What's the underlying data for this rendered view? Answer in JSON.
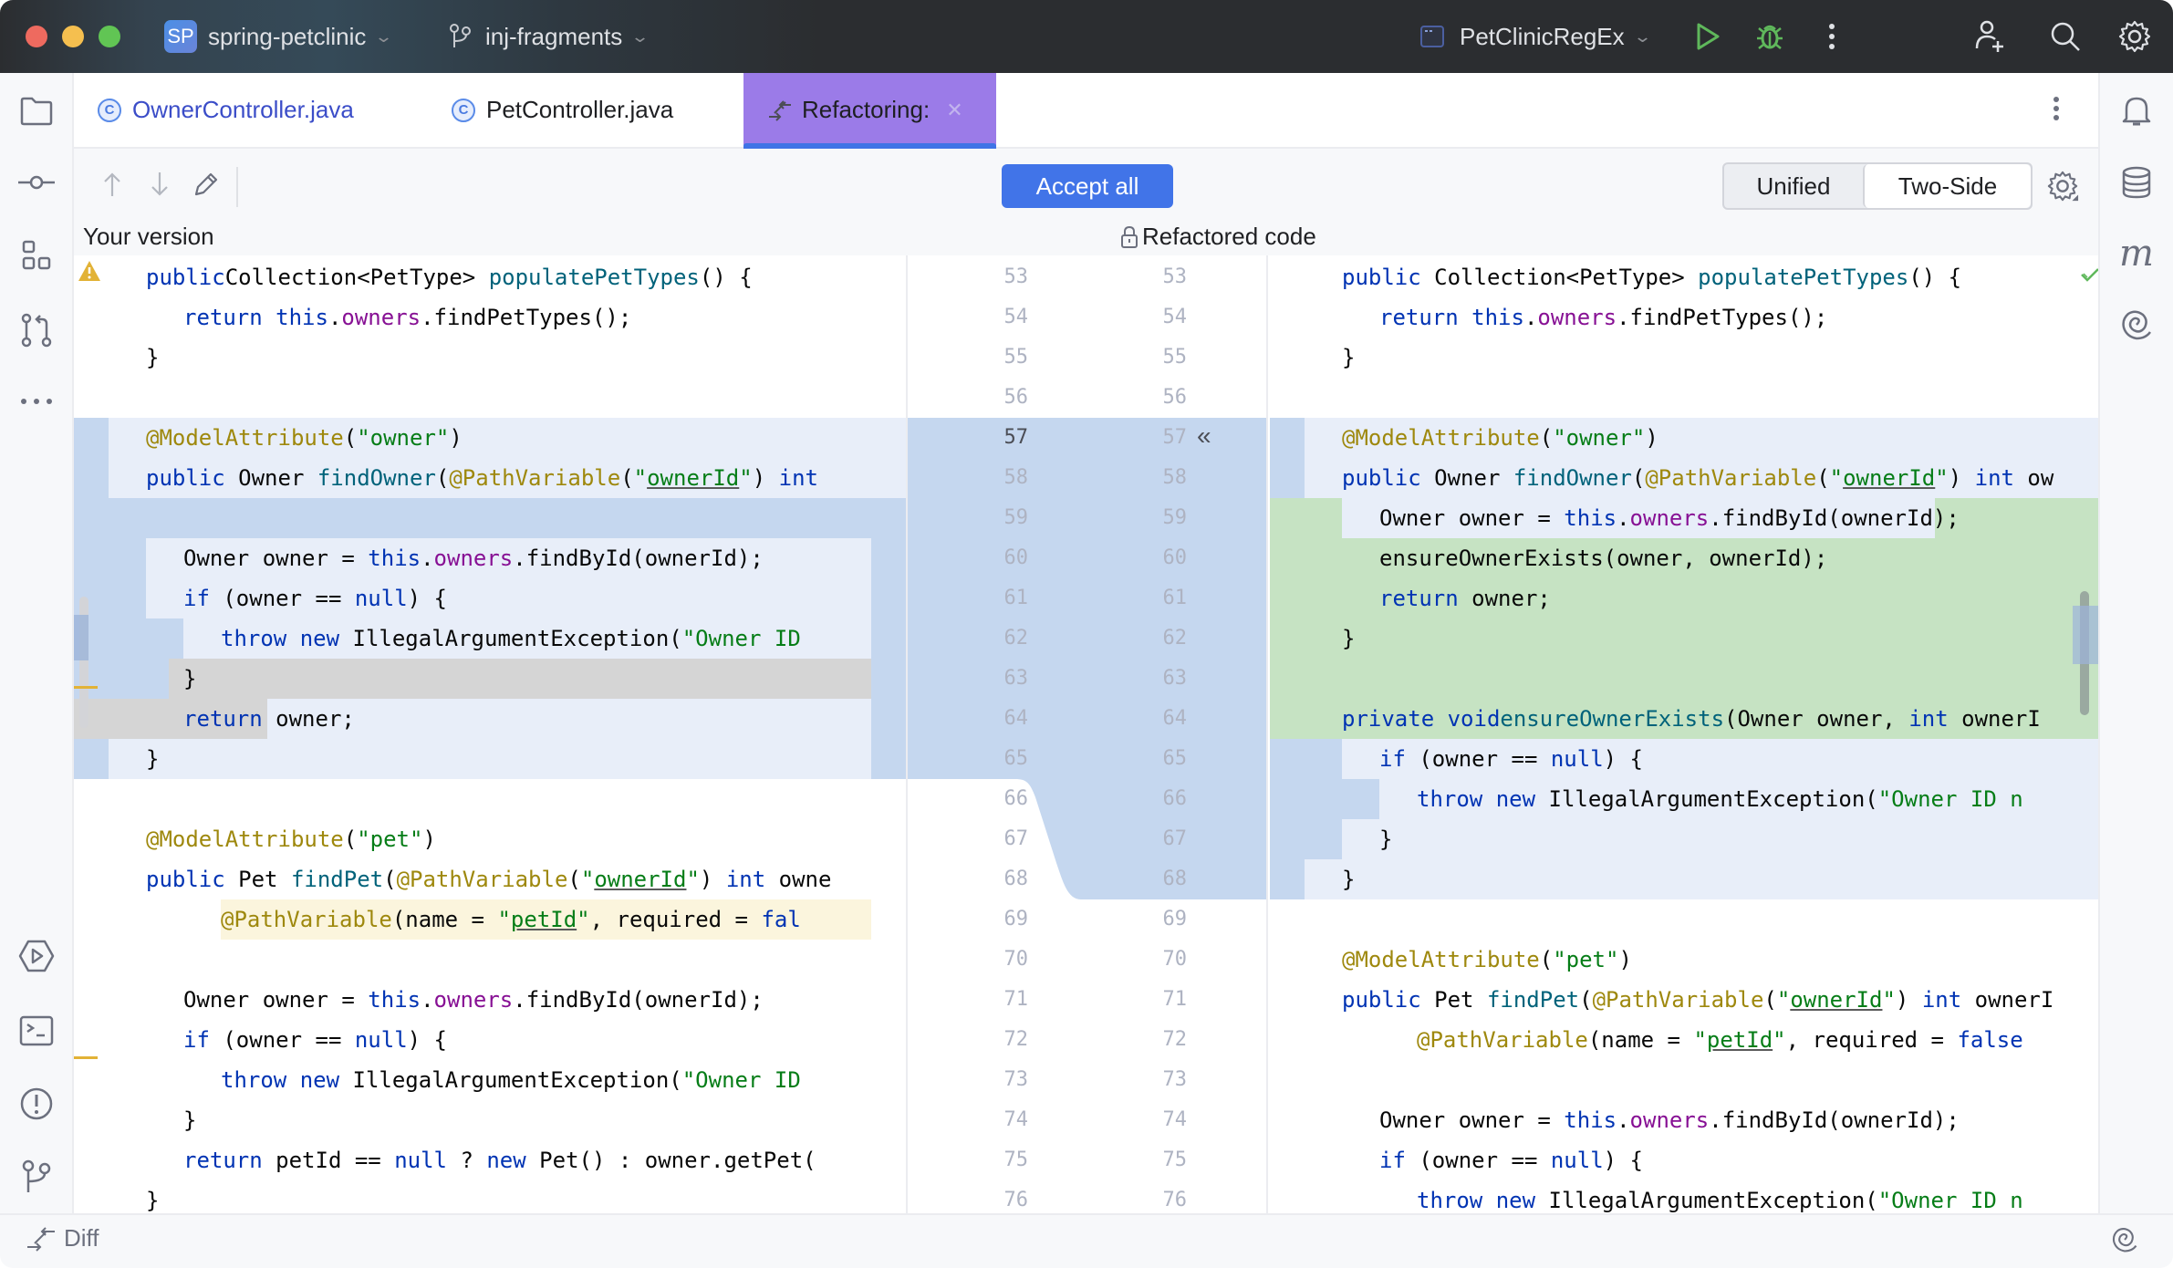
{
  "titlebar": {
    "project_badge": "SP",
    "project_name": "spring-petclinic",
    "branch_name": "inj-fragments",
    "run_config": "PetClinicRegEx",
    "colors": {
      "run": "#5fb85b",
      "debug": "#5fb85b"
    }
  },
  "tabs": [
    {
      "label": "OwnerController.java",
      "icon": "class-icon"
    },
    {
      "label": "PetController.java",
      "icon": "class-icon"
    },
    {
      "label": "Refactoring:",
      "icon": "refactor-icon",
      "active": true
    }
  ],
  "toolbar": {
    "accept_all": "Accept all",
    "view_modes": [
      "Unified",
      "Two-Side"
    ],
    "selected_view": "Two-Side",
    "accent_color": "#4174e8"
  },
  "labels": {
    "left": "Your version",
    "right": "Refactored code"
  },
  "left_lines": [
    {
      "n": 53,
      "indent": 1,
      "tokens": [
        [
          "k",
          "public"
        ],
        [
          "",
          "Collection<PetType> "
        ],
        [
          "f",
          "populatePetTypes"
        ],
        [
          "",
          "() {"
        ]
      ]
    },
    {
      "n": 54,
      "indent": 2,
      "tokens": [
        [
          "k",
          "return this"
        ],
        [
          "",
          "."
        ],
        [
          "m",
          "owners"
        ],
        [
          "",
          ".findPetTypes();"
        ]
      ]
    },
    {
      "n": 55,
      "indent": 1,
      "tokens": [
        [
          "",
          "}"
        ]
      ]
    },
    {
      "n": 56,
      "indent": 0,
      "tokens": []
    },
    {
      "n": 57,
      "indent": 1,
      "tokens": [
        [
          "a",
          "@ModelAttribute"
        ],
        [
          "",
          "("
        ],
        [
          "s",
          "\"owner\""
        ],
        [
          "",
          ")"
        ]
      ]
    },
    {
      "n": 58,
      "indent": 1,
      "tokens": [
        [
          "k",
          "public"
        ],
        [
          "",
          " Owner "
        ],
        [
          "f",
          "findOwner"
        ],
        [
          "",
          "("
        ],
        [
          "a",
          "@PathVariable"
        ],
        [
          "",
          "("
        ],
        [
          "s",
          "\""
        ],
        [
          "su",
          "ownerId"
        ],
        [
          "s",
          "\""
        ],
        [
          "",
          ") "
        ],
        [
          "k",
          "int"
        ]
      ]
    },
    {
      "n": 59,
      "indent": 0,
      "tokens": []
    },
    {
      "n": 60,
      "indent": 2,
      "tokens": [
        [
          "",
          "Owner owner = "
        ],
        [
          "k",
          "this"
        ],
        [
          "",
          "."
        ],
        [
          "m",
          "owners"
        ],
        [
          "",
          ".findById(ownerId);"
        ]
      ]
    },
    {
      "n": 61,
      "indent": 2,
      "tokens": [
        [
          "k",
          "if"
        ],
        [
          "",
          " (owner == "
        ],
        [
          "k",
          "null"
        ],
        [
          "",
          ") {"
        ]
      ]
    },
    {
      "n": 62,
      "indent": 3,
      "tokens": [
        [
          "k",
          "throw new"
        ],
        [
          "",
          " IllegalArgumentException("
        ],
        [
          "s",
          "\"Owner ID"
        ]
      ]
    },
    {
      "n": 63,
      "indent": 2,
      "tokens": [
        [
          "",
          "}"
        ]
      ]
    },
    {
      "n": 64,
      "indent": 2,
      "tokens": [
        [
          "k",
          "return"
        ],
        [
          "",
          " owner;"
        ]
      ]
    },
    {
      "n": 65,
      "indent": 1,
      "tokens": [
        [
          "",
          "}"
        ]
      ]
    },
    {
      "n": 66,
      "indent": 0,
      "tokens": []
    },
    {
      "n": 67,
      "indent": 1,
      "tokens": [
        [
          "a",
          "@ModelAttribute"
        ],
        [
          "",
          "("
        ],
        [
          "s",
          "\"pet\""
        ],
        [
          "",
          ")"
        ]
      ]
    },
    {
      "n": 68,
      "indent": 1,
      "tokens": [
        [
          "k",
          "public"
        ],
        [
          "",
          " Pet "
        ],
        [
          "f",
          "findPet"
        ],
        [
          "",
          "("
        ],
        [
          "a",
          "@PathVariable"
        ],
        [
          "",
          "("
        ],
        [
          "s",
          "\""
        ],
        [
          "su",
          "ownerId"
        ],
        [
          "s",
          "\""
        ],
        [
          "",
          ") "
        ],
        [
          "k",
          "int"
        ],
        [
          "",
          " owne"
        ]
      ]
    },
    {
      "n": 69,
      "indent": 3,
      "tokens": [
        [
          "a",
          "@PathVariable"
        ],
        [
          "",
          "(name = "
        ],
        [
          "s",
          "\""
        ],
        [
          "su",
          "petId"
        ],
        [
          "s",
          "\""
        ],
        [
          "",
          ", required = "
        ],
        [
          "k",
          "fal"
        ]
      ]
    },
    {
      "n": 70,
      "indent": 0,
      "tokens": []
    },
    {
      "n": 71,
      "indent": 2,
      "tokens": [
        [
          "",
          "Owner owner = "
        ],
        [
          "k",
          "this"
        ],
        [
          "",
          "."
        ],
        [
          "m",
          "owners"
        ],
        [
          "",
          ".findById(ownerId);"
        ]
      ]
    },
    {
      "n": 72,
      "indent": 2,
      "tokens": [
        [
          "k",
          "if"
        ],
        [
          "",
          " (owner == "
        ],
        [
          "k",
          "null"
        ],
        [
          "",
          ") {"
        ]
      ]
    },
    {
      "n": 73,
      "indent": 3,
      "tokens": [
        [
          "k",
          "throw new"
        ],
        [
          "",
          " IllegalArgumentException("
        ],
        [
          "s",
          "\"Owner ID"
        ]
      ]
    },
    {
      "n": 74,
      "indent": 2,
      "tokens": [
        [
          "",
          "}"
        ]
      ]
    },
    {
      "n": 75,
      "indent": 2,
      "tokens": [
        [
          "k",
          "return"
        ],
        [
          "",
          " petId == "
        ],
        [
          "k",
          "null"
        ],
        [
          "",
          " ? "
        ],
        [
          "k",
          "new"
        ],
        [
          "",
          " Pet() : owner.getPet("
        ]
      ]
    },
    {
      "n": 76,
      "indent": 1,
      "tokens": [
        [
          "",
          "}"
        ]
      ]
    }
  ],
  "right_lines": [
    {
      "n": 53,
      "indent": 1,
      "tokens": [
        [
          "k",
          "public"
        ],
        [
          "",
          " Collection<PetType> "
        ],
        [
          "f",
          "populatePetTypes"
        ],
        [
          "",
          "() {"
        ]
      ]
    },
    {
      "n": 54,
      "indent": 2,
      "tokens": [
        [
          "k",
          "return this"
        ],
        [
          "",
          "."
        ],
        [
          "m",
          "owners"
        ],
        [
          "",
          ".findPetTypes();"
        ]
      ]
    },
    {
      "n": 55,
      "indent": 1,
      "tokens": [
        [
          "",
          "}"
        ]
      ]
    },
    {
      "n": 56,
      "indent": 0,
      "tokens": []
    },
    {
      "n": 57,
      "indent": 1,
      "tokens": [
        [
          "a",
          "@ModelAttribute"
        ],
        [
          "",
          "("
        ],
        [
          "s",
          "\"owner\""
        ],
        [
          "",
          ")"
        ]
      ]
    },
    {
      "n": 58,
      "indent": 1,
      "tokens": [
        [
          "k",
          "public"
        ],
        [
          "",
          " Owner "
        ],
        [
          "f",
          "findOwner"
        ],
        [
          "",
          "("
        ],
        [
          "a",
          "@PathVariable"
        ],
        [
          "",
          "("
        ],
        [
          "s",
          "\""
        ],
        [
          "su",
          "ownerId"
        ],
        [
          "s",
          "\""
        ],
        [
          "",
          ") "
        ],
        [
          "k",
          "int"
        ],
        [
          "",
          " ow"
        ]
      ]
    },
    {
      "n": 59,
      "indent": 2,
      "tokens": [
        [
          "",
          "Owner owner = "
        ],
        [
          "k",
          "this"
        ],
        [
          "",
          "."
        ],
        [
          "m",
          "owners"
        ],
        [
          "",
          ".findById(ownerId);"
        ]
      ]
    },
    {
      "n": 60,
      "indent": 2,
      "tokens": [
        [
          "",
          "ensureOwnerExists(owner, ownerId);"
        ]
      ]
    },
    {
      "n": 61,
      "indent": 2,
      "tokens": [
        [
          "k",
          "return"
        ],
        [
          "",
          " owner;"
        ]
      ]
    },
    {
      "n": 62,
      "indent": 1,
      "tokens": [
        [
          "",
          "}"
        ]
      ]
    },
    {
      "n": 63,
      "indent": 0,
      "tokens": []
    },
    {
      "n": 64,
      "indent": 1,
      "tokens": [
        [
          "k",
          "private void"
        ],
        [
          " ",
          ""
        ],
        [
          "f",
          "ensureOwnerExists"
        ],
        [
          "",
          "(Owner owner, "
        ],
        [
          "k",
          "int"
        ],
        [
          "",
          " ownerI"
        ]
      ]
    },
    {
      "n": 65,
      "indent": 2,
      "tokens": [
        [
          "k",
          "if"
        ],
        [
          "",
          " (owner == "
        ],
        [
          "k",
          "null"
        ],
        [
          "",
          ") {"
        ]
      ]
    },
    {
      "n": 66,
      "indent": 3,
      "tokens": [
        [
          "k",
          "throw new"
        ],
        [
          "",
          " IllegalArgumentException("
        ],
        [
          "s",
          "\"Owner ID n"
        ]
      ]
    },
    {
      "n": 67,
      "indent": 2,
      "tokens": [
        [
          "",
          "}"
        ]
      ]
    },
    {
      "n": 68,
      "indent": 1,
      "tokens": [
        [
          "",
          "}"
        ]
      ]
    },
    {
      "n": 69,
      "indent": 0,
      "tokens": []
    },
    {
      "n": 70,
      "indent": 1,
      "tokens": [
        [
          "a",
          "@ModelAttribute"
        ],
        [
          "",
          "("
        ],
        [
          "s",
          "\"pet\""
        ],
        [
          "",
          ")"
        ]
      ]
    },
    {
      "n": 71,
      "indent": 1,
      "tokens": [
        [
          "k",
          "public"
        ],
        [
          "",
          " Pet "
        ],
        [
          "f",
          "findPet"
        ],
        [
          "",
          "("
        ],
        [
          "a",
          "@PathVariable"
        ],
        [
          "",
          "("
        ],
        [
          "s",
          "\""
        ],
        [
          "su",
          "ownerId"
        ],
        [
          "s",
          "\""
        ],
        [
          "",
          ") "
        ],
        [
          "k",
          "int"
        ],
        [
          "",
          " ownerI"
        ]
      ]
    },
    {
      "n": 72,
      "indent": 3,
      "tokens": [
        [
          "a",
          "@PathVariable"
        ],
        [
          "",
          "(name = "
        ],
        [
          "s",
          "\""
        ],
        [
          "su",
          "petId"
        ],
        [
          "s",
          "\""
        ],
        [
          "",
          ", required = "
        ],
        [
          "k",
          "false"
        ]
      ]
    },
    {
      "n": 73,
      "indent": 0,
      "tokens": []
    },
    {
      "n": 74,
      "indent": 2,
      "tokens": [
        [
          "",
          "Owner owner = "
        ],
        [
          "k",
          "this"
        ],
        [
          "",
          "."
        ],
        [
          "m",
          "owners"
        ],
        [
          "",
          ".findById(ownerId);"
        ]
      ]
    },
    {
      "n": 75,
      "indent": 2,
      "tokens": [
        [
          "k",
          "if"
        ],
        [
          "",
          " (owner == "
        ],
        [
          "k",
          "null"
        ],
        [
          "",
          ") {"
        ]
      ]
    },
    {
      "n": 76,
      "indent": 3,
      "tokens": [
        [
          "k",
          "throw new"
        ],
        [
          "",
          " IllegalArgumentException("
        ],
        [
          "s",
          "\"Owner ID n"
        ]
      ]
    }
  ],
  "gutter": {
    "left_numbers": [
      53,
      54,
      55,
      56,
      57,
      58,
      59,
      60,
      61,
      62,
      63,
      64,
      65,
      66,
      67,
      68,
      69,
      70,
      71,
      72,
      73,
      74,
      75,
      76
    ],
    "right_numbers": [
      53,
      54,
      55,
      56,
      57,
      58,
      59,
      60,
      61,
      62,
      63,
      64,
      65,
      66,
      67,
      68,
      69,
      70,
      71,
      72,
      73,
      74,
      75,
      76
    ],
    "apply_change_icon": "«"
  },
  "statusbar": {
    "label": "Diff"
  },
  "colors": {
    "changed_bg": "#e8eef9",
    "changed_strong": "#c5d7ef",
    "inserted_bg": "#c6e3c3",
    "deleted_bg": "#d5d5d5",
    "warning": "#e2b236"
  }
}
